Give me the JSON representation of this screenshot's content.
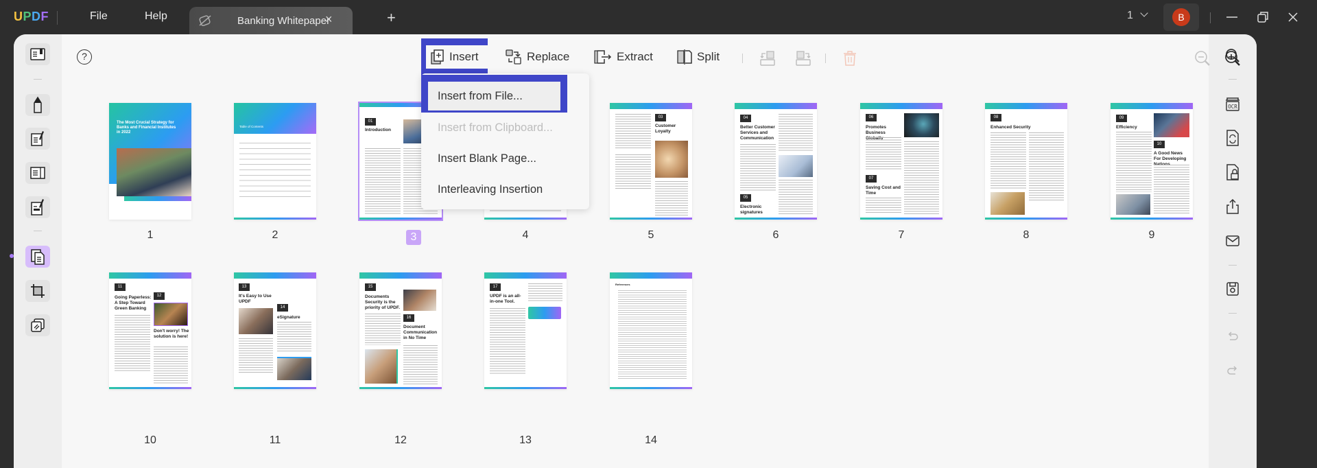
{
  "app": {
    "logo": [
      "U",
      "P",
      "D",
      "F"
    ],
    "menu": {
      "file": "File",
      "help": "Help"
    },
    "tab": {
      "title": "Banking Whitepaper",
      "close": "×"
    },
    "new_tab": "+",
    "page_selector": "1",
    "avatar_initial": "B"
  },
  "toolbar": {
    "help": "?",
    "insert": "Insert",
    "replace": "Replace",
    "extract": "Extract",
    "split": "Split"
  },
  "insert_menu": {
    "items": [
      {
        "label": "Insert from File...",
        "enabled": true
      },
      {
        "label": "Insert from Clipboard...",
        "enabled": false
      },
      {
        "label": "Insert Blank Page...",
        "enabled": true
      },
      {
        "label": "Interleaving Insertion",
        "enabled": true
      }
    ]
  },
  "pages": [
    {
      "number": "1",
      "selected": false,
      "title": "The Most Crucial Strategy for Banks and Financial Institutes in 2022"
    },
    {
      "number": "2",
      "selected": false,
      "title": "Table of Contents"
    },
    {
      "number": "3",
      "selected": true,
      "section": "01",
      "title": "Introduction"
    },
    {
      "number": "4",
      "selected": false
    },
    {
      "number": "5",
      "selected": false,
      "section": "03",
      "title": "Customer Loyalty"
    },
    {
      "number": "6",
      "selected": false,
      "section": "04",
      "title": "Better Customer Services and Communication",
      "section2": "05",
      "title2": "Electronic signatures"
    },
    {
      "number": "7",
      "selected": false,
      "section": "06",
      "title": "Promotes Business Globally",
      "section2": "07",
      "title2": "Saving Cost and Time"
    },
    {
      "number": "8",
      "selected": false,
      "section": "08",
      "title": "Enhanced Security"
    },
    {
      "number": "9",
      "selected": false,
      "section": "09",
      "title": "Efficiency",
      "section2": "10",
      "title2": "A Good News For Developing Nations"
    },
    {
      "number": "10",
      "selected": false,
      "section": "11",
      "title": "Going Paperless: A Step Toward Green Banking",
      "section2": "12",
      "title2": "Don't worry! The solution is here!"
    },
    {
      "number": "11",
      "selected": false,
      "section": "13",
      "title": "It's Easy to Use UPDF",
      "section2": "14",
      "title2": "eSignature"
    },
    {
      "number": "12",
      "selected": false,
      "section": "15",
      "title": "Documents Security is the priority of UPDF.",
      "section2": "16",
      "title2": "Document Communication in No Time"
    },
    {
      "number": "13",
      "selected": false,
      "section": "17",
      "title": "UPDF is an all-in-one Tool."
    },
    {
      "number": "14",
      "selected": false,
      "title": "References"
    }
  ],
  "colors": {
    "accent": "#3f46c8",
    "selected_page": "#c9a6f8",
    "avatar": "#c83a1a",
    "active_rail": "#d7bdfb"
  }
}
